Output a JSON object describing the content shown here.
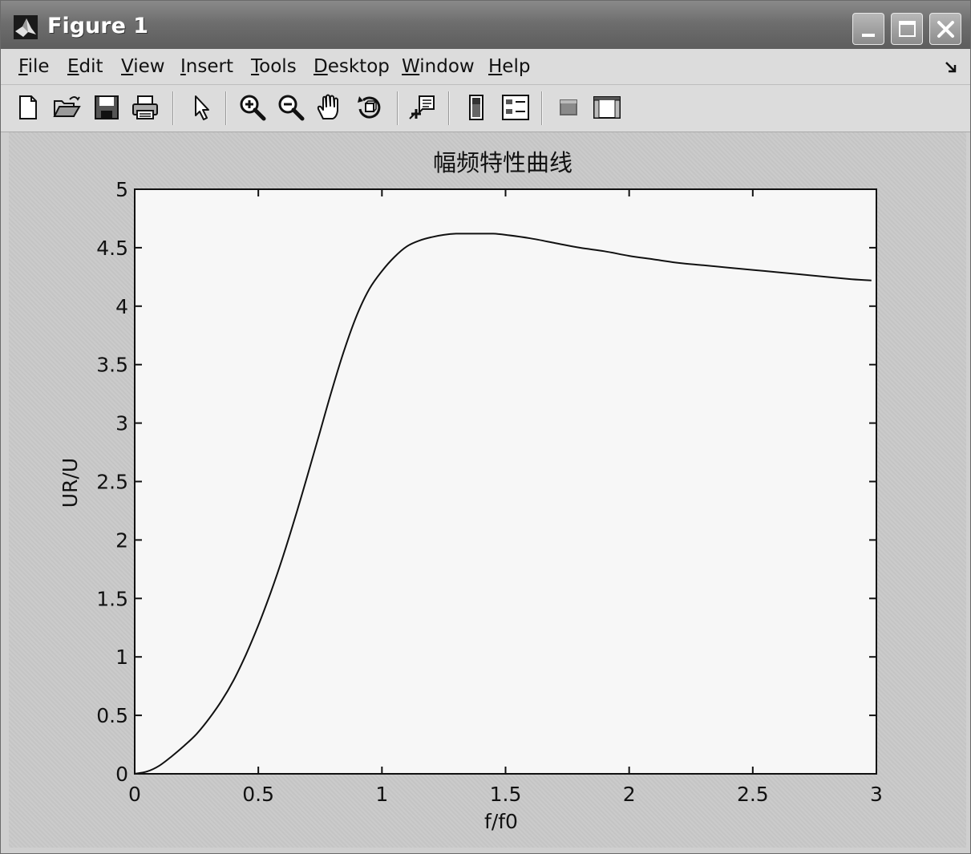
{
  "window": {
    "title": "Figure 1"
  },
  "menu": {
    "items": [
      "File",
      "Edit",
      "View",
      "Insert",
      "Tools",
      "Desktop",
      "Window",
      "Help"
    ]
  },
  "toolbar": {
    "tools": [
      "new-figure-icon",
      "open-file-icon",
      "save-icon",
      "print-icon",
      "edit-plot-arrow-icon",
      "zoom-in-icon",
      "zoom-out-icon",
      "pan-hand-icon",
      "rotate-3d-icon",
      "data-cursor-icon",
      "colorbar-icon",
      "legend-icon",
      "hide-plot-tools-icon",
      "show-plot-tools-icon"
    ]
  },
  "chart_data": {
    "type": "line",
    "title": "幅频特性曲线",
    "xlabel": "f/f0",
    "ylabel": "UR/U",
    "xlim": [
      0,
      3
    ],
    "ylim": [
      0,
      5
    ],
    "xticks": [
      "0",
      "0.5",
      "1",
      "1.5",
      "2",
      "2.5",
      "3"
    ],
    "yticks": [
      "0",
      "0.5",
      "1",
      "1.5",
      "2",
      "2.5",
      "3",
      "3.5",
      "4",
      "4.5",
      "5"
    ],
    "grid": false,
    "legend": "none",
    "line_color": "#111111",
    "series": [
      {
        "x": [
          0,
          0.05,
          0.1,
          0.15,
          0.2,
          0.25,
          0.3,
          0.35,
          0.4,
          0.45,
          0.5,
          0.55,
          0.6,
          0.65,
          0.7,
          0.75,
          0.8,
          0.85,
          0.9,
          0.95,
          1.0,
          1.05,
          1.1,
          1.15,
          1.2,
          1.25,
          1.3,
          1.35,
          1.4,
          1.45,
          1.5,
          1.6,
          1.7,
          1.8,
          1.9,
          2.0,
          2.1,
          2.2,
          2.3,
          2.4,
          2.5,
          2.6,
          2.7,
          2.8,
          2.9,
          2.98
        ],
        "y": [
          0.0,
          0.02,
          0.07,
          0.15,
          0.24,
          0.34,
          0.47,
          0.62,
          0.8,
          1.02,
          1.27,
          1.55,
          1.86,
          2.2,
          2.56,
          2.93,
          3.3,
          3.64,
          3.93,
          4.15,
          4.3,
          4.42,
          4.51,
          4.56,
          4.59,
          4.61,
          4.62,
          4.62,
          4.62,
          4.62,
          4.61,
          4.58,
          4.54,
          4.5,
          4.47,
          4.43,
          4.4,
          4.37,
          4.35,
          4.33,
          4.31,
          4.29,
          4.27,
          4.25,
          4.23,
          4.22
        ]
      }
    ]
  }
}
